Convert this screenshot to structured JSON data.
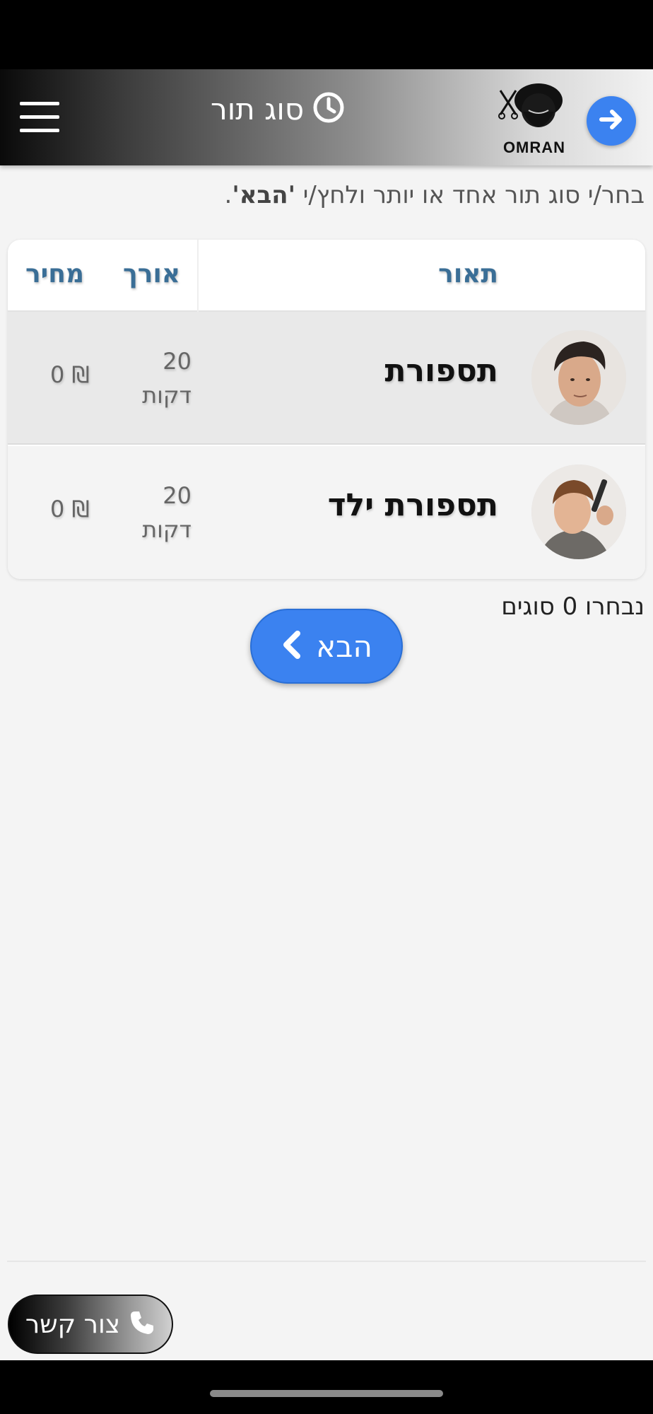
{
  "header": {
    "title": "סוג תור",
    "logo_text": "OMRAN",
    "icons": {
      "menu": "hamburger-menu-icon",
      "clock": "clock-icon",
      "forward": "arrow-right-icon"
    }
  },
  "instruction": {
    "text_before": "בחר/י סוג תור אחד או יותר ולחץ/י ",
    "button_ref": "'הבא'",
    "text_after": "."
  },
  "table": {
    "headers": {
      "description": "תאור",
      "length": "אורך",
      "price": "מחיר"
    },
    "rows": [
      {
        "name": "תספורת",
        "duration_value": "20",
        "duration_unit": "דקות",
        "price": "0 ₪",
        "image": "man-haircut-photo"
      },
      {
        "name": "תספורת ילד",
        "duration_value": "20",
        "duration_unit": "דקות",
        "price": "0 ₪",
        "image": "child-haircut-photo"
      }
    ]
  },
  "selection": {
    "count_text": "נבחרו 0 סוגים"
  },
  "next_button": {
    "label": "הבא",
    "icon": "chevron-left-icon"
  },
  "contact_button": {
    "label": "צור קשר",
    "icon": "phone-icon"
  },
  "colors": {
    "accent": "#3b82f0",
    "header_text": "#3a6e96",
    "background": "#f4f4f4"
  }
}
